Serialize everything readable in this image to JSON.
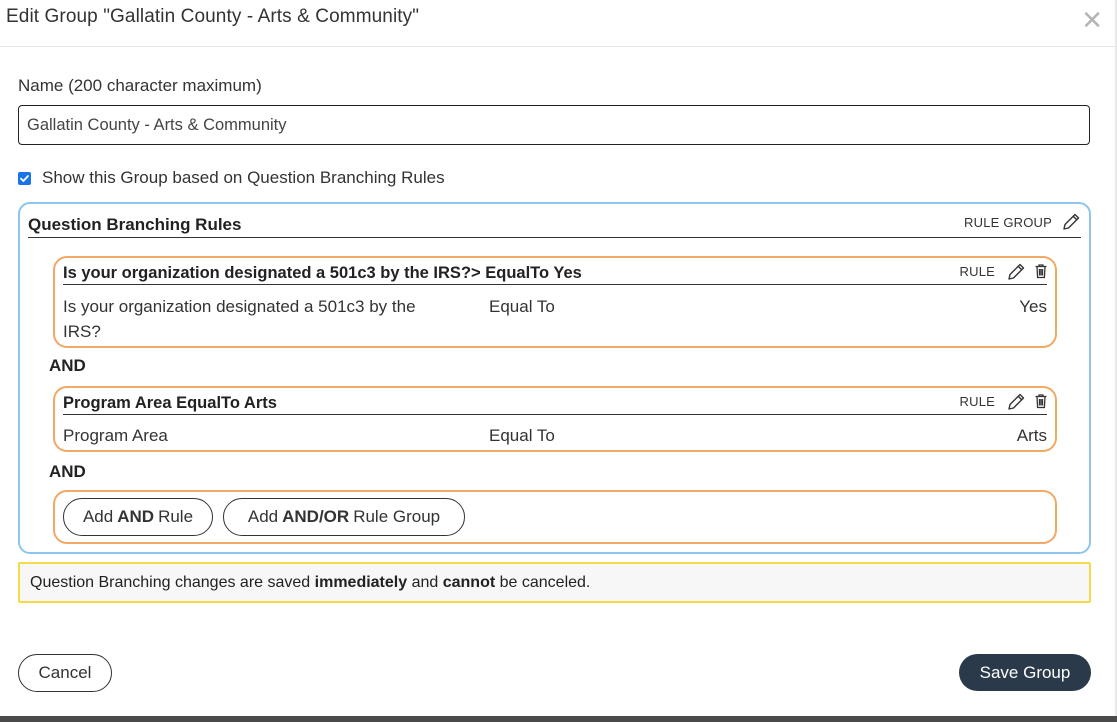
{
  "dialog": {
    "title": "Edit Group \"Gallatin County - Arts & Community\"",
    "close_glyph": "✕"
  },
  "name_field": {
    "label": "Name (200 character maximum)",
    "value": "Gallatin County - Arts & Community"
  },
  "branching_toggle": {
    "checked": true,
    "label": "Show this Group based on Question Branching Rules"
  },
  "rules_group": {
    "title": "Question Branching Rules",
    "badge": "RULE GROUP",
    "rules": [
      {
        "title": "Is your organization designated a 501c3 by the IRS?> EqualTo Yes",
        "badge": "RULE",
        "question": "Is your organization designated a 501c3 by the IRS?",
        "operator": "Equal To",
        "value": "Yes"
      },
      {
        "title": "Program Area EqualTo Arts",
        "badge": "RULE",
        "question": "Program Area",
        "operator": "Equal To",
        "value": "Arts"
      }
    ],
    "connectors": [
      "AND",
      "AND"
    ],
    "add_and_rule": {
      "prefix": "Add",
      "bold": "AND",
      "suffix": "Rule"
    },
    "add_andor_group": {
      "prefix": "Add",
      "bold": "AND/OR",
      "suffix": "Rule Group"
    }
  },
  "notice": {
    "part1": "Question Branching changes are saved",
    "bold1": "immediately",
    "part2": "and",
    "bold2": "cannot",
    "part3": "be canceled."
  },
  "footer": {
    "cancel_label": "Cancel",
    "save_label": "Save Group"
  },
  "colors": {
    "rule_group_border": "#8ec5ee",
    "rule_border": "#f2a963",
    "notice_border": "#f5d949",
    "primary_button": "#2b3a4a",
    "checkbox": "#1a73e8"
  },
  "icons": [
    "close-icon",
    "checkbox-checked-icon",
    "pencil-icon",
    "trash-icon"
  ]
}
